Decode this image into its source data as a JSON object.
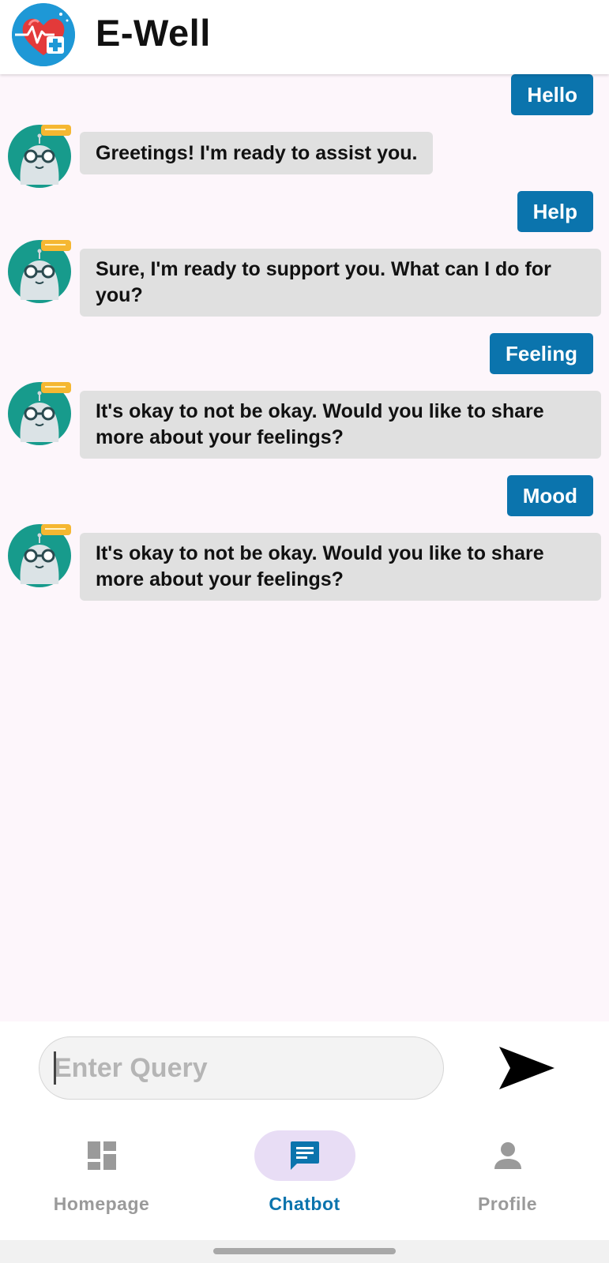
{
  "app": {
    "title": "E-Well",
    "logo_icon": "heart-medical-icon"
  },
  "colors": {
    "user_bubble": "#0b74ad",
    "bot_bubble": "#e0e0e0",
    "accent": "#0b74ad",
    "background": "#fdf6fb"
  },
  "chat": {
    "messages": [
      {
        "sender": "user",
        "text": "Hello"
      },
      {
        "sender": "bot",
        "text": "Greetings! I'm ready to assist you."
      },
      {
        "sender": "user",
        "text": "Help"
      },
      {
        "sender": "bot",
        "text": "Sure, I'm ready to support you. What can I do for you?"
      },
      {
        "sender": "user",
        "text": "Feeling"
      },
      {
        "sender": "bot",
        "text": "It's okay to not be okay. Would you like to share more about your feelings?"
      },
      {
        "sender": "user",
        "text": "Mood"
      },
      {
        "sender": "bot",
        "text": "It's okay to not be okay. Would you like to share more about your feelings?"
      }
    ],
    "bot_avatar_icon": "robot-avatar-icon"
  },
  "input": {
    "placeholder": "Enter Query",
    "value": "",
    "send_icon": "send-icon"
  },
  "nav": {
    "items": [
      {
        "label": "Homepage",
        "icon": "dashboard-icon",
        "active": false
      },
      {
        "label": "Chatbot",
        "icon": "chat-icon",
        "active": true
      },
      {
        "label": "Profile",
        "icon": "person-icon",
        "active": false
      }
    ]
  }
}
